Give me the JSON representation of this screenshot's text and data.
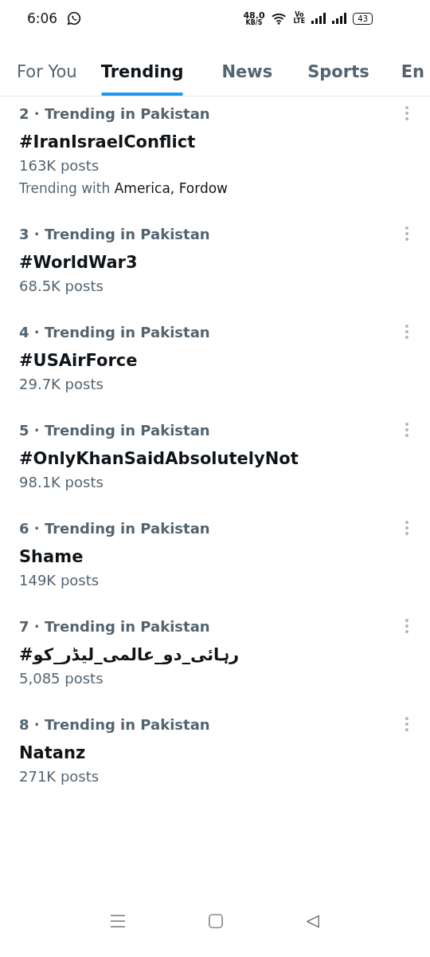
{
  "status_bar": {
    "time": "6:06",
    "speed": "48.0",
    "speed_unit": "KB/S",
    "volte_top": "Vo",
    "volte_bottom": "LTE",
    "battery": "43"
  },
  "tabs": [
    {
      "label": "For You",
      "selected": false
    },
    {
      "label": "Trending",
      "selected": true
    },
    {
      "label": "News",
      "selected": false
    },
    {
      "label": "Sports",
      "selected": false
    },
    {
      "label": "En",
      "selected": false
    }
  ],
  "trends": [
    {
      "context": "2 · Trending in Pakistan",
      "title": "#IranIsraelConflict",
      "posts": "163K posts",
      "with_label": "Trending with",
      "with_topics": "America, Fordow"
    },
    {
      "context": "3 · Trending in Pakistan",
      "title": "#WorldWar3",
      "posts": "68.5K posts"
    },
    {
      "context": "4 · Trending in Pakistan",
      "title": "#USAirForce",
      "posts": "29.7K posts"
    },
    {
      "context": "5 · Trending in Pakistan",
      "title": "#OnlyKhanSaidAbsolutelyNot",
      "posts": "98.1K posts"
    },
    {
      "context": "6 · Trending in Pakistan",
      "title": "Shame",
      "posts": "149K posts"
    },
    {
      "context": "7 · Trending in Pakistan",
      "title": "#رہائی_دو_عالمی_لیڈر_کو",
      "posts": "5,085 posts"
    },
    {
      "context": "8 · Trending in Pakistan",
      "title": "Natanz",
      "posts": "271K posts"
    }
  ]
}
